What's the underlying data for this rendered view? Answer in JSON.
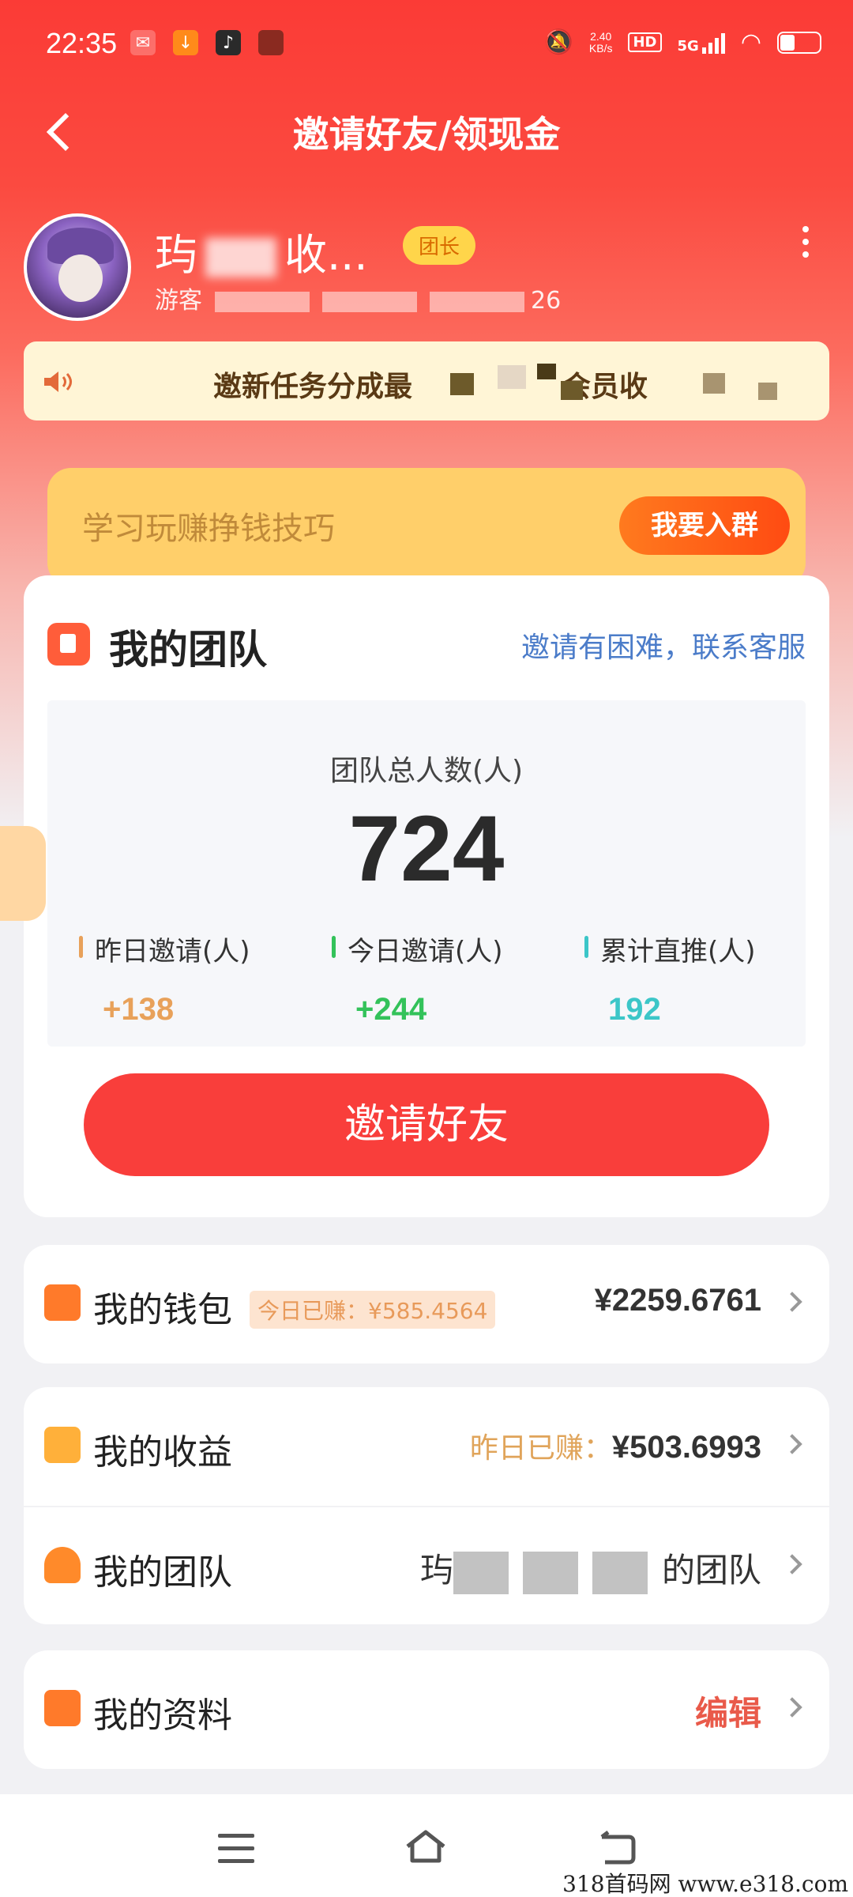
{
  "status_bar": {
    "time": "22:35",
    "net_speed_value": "2.40",
    "net_speed_unit": "KB/s",
    "hd_label": "HD",
    "network": "5G"
  },
  "header": {
    "title": "邀请好友/领现金"
  },
  "profile": {
    "name_prefix": "玙",
    "name_suffix": "收...",
    "badge": "团长",
    "subinfo_prefix": "游客",
    "subinfo_suffix": "26"
  },
  "notice": {
    "text_a": "邀新任务分成最",
    "text_b": "会员收"
  },
  "group_banner": {
    "text": "学习玩赚挣钱技巧",
    "button": "我要入群"
  },
  "team_card": {
    "title": "我的团队",
    "help_link": "邀请有困难，联系客服",
    "total_label": "团队总人数(人)",
    "total_value": "724",
    "stats": [
      {
        "label": "昨日邀请(人)",
        "value": "+138",
        "color": "#e8a15a"
      },
      {
        "label": "今日邀请(人)",
        "value": "+244",
        "color": "#33c25a"
      },
      {
        "label": "累计直推(人)",
        "value": "192",
        "color": "#3cc6c8"
      }
    ],
    "invite_button": "邀请好友"
  },
  "wallet": {
    "label": "我的钱包",
    "today_pill": "今日已赚：¥585.4564",
    "amount": "¥2259.6761"
  },
  "earnings": {
    "label": "我的收益",
    "yesterday_label": "昨日已赚：",
    "yesterday_value": "¥503.6993"
  },
  "my_team_row": {
    "label": "我的团队",
    "team_name_prefix": "玙",
    "team_name_suffix": "的团队"
  },
  "profile_row": {
    "label": "我的资料",
    "action": "编辑"
  },
  "watermark": "318首码网 www.e318.com",
  "colors": {
    "primary_red": "#f93e3b",
    "link_blue": "#4b7cc9",
    "gold": "#e0a45a"
  }
}
